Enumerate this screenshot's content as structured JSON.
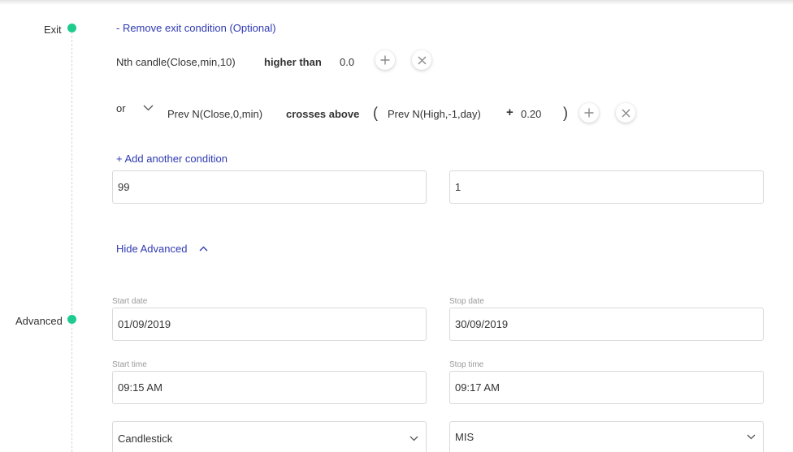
{
  "exit_section": {
    "label": "Exit",
    "remove_link": "- Remove exit condition (Optional)",
    "condition1": {
      "left": "Nth candle(Close,min,10)",
      "operator": "higher than",
      "right": "0.0"
    },
    "condition2": {
      "joiner": "or",
      "left": "Prev N(Close,0,min)",
      "operator": "crosses above",
      "open_paren": "(",
      "right": "Prev N(High,-1,day)",
      "plus": "+",
      "offset": "0.20",
      "close_paren": ")"
    },
    "add_link": "+ Add another condition",
    "field_left_value": "99",
    "field_right_value": "1"
  },
  "advanced_toggle": {
    "label": "Hide Advanced"
  },
  "advanced_section": {
    "label": "Advanced",
    "start_date": {
      "label": "Start date",
      "value": "01/09/2019"
    },
    "stop_date": {
      "label": "Stop date",
      "value": "30/09/2019"
    },
    "start_time": {
      "label": "Start time",
      "value": "09:15 AM"
    },
    "stop_time": {
      "label": "Stop time",
      "value": "09:17 AM"
    },
    "chart_type": {
      "value": "Candlestick"
    },
    "product": {
      "value": "MIS"
    }
  },
  "colors": {
    "accent_green": "#1fcb8f",
    "link_blue": "#2f3ab2"
  }
}
